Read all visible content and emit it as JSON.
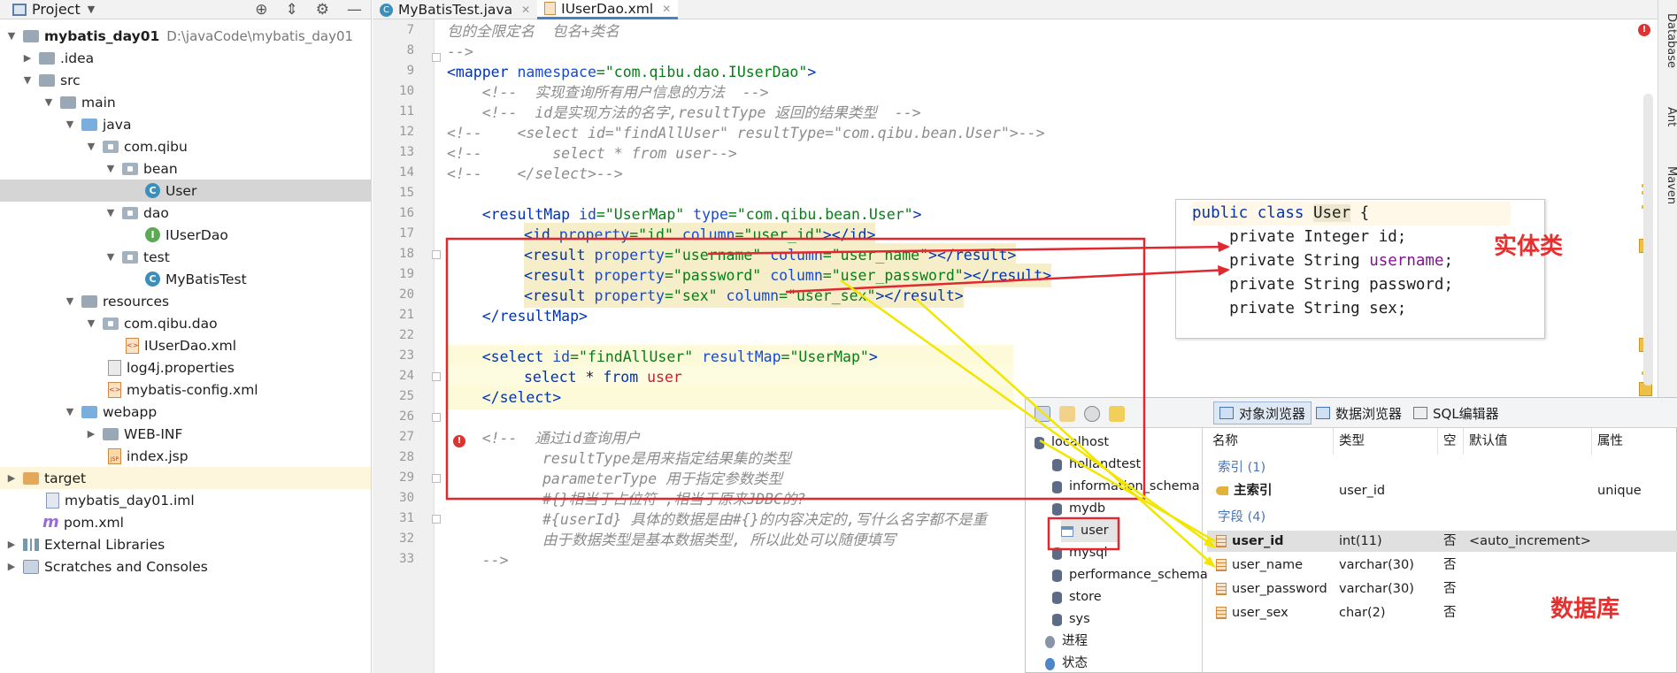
{
  "project_panel": {
    "title": "Project",
    "tree": [
      {
        "label": "mybatis_day01",
        "hint": "D:\\javaCode\\mybatis_day01"
      },
      {
        "label": ".idea"
      },
      {
        "label": "src"
      },
      {
        "label": "main"
      },
      {
        "label": "java"
      },
      {
        "label": "com.qibu"
      },
      {
        "label": "bean"
      },
      {
        "label": "User"
      },
      {
        "label": "dao"
      },
      {
        "label": "IUserDao"
      },
      {
        "label": "test"
      },
      {
        "label": "MyBatisTest"
      },
      {
        "label": "resources"
      },
      {
        "label": "com.qibu.dao"
      },
      {
        "label": "IUserDao.xml"
      },
      {
        "label": "log4j.properties"
      },
      {
        "label": "mybatis-config.xml"
      },
      {
        "label": "webapp"
      },
      {
        "label": "WEB-INF"
      },
      {
        "label": "index.jsp"
      },
      {
        "label": "target"
      },
      {
        "label": "mybatis_day01.iml"
      },
      {
        "label": "pom.xml"
      },
      {
        "label": "External Libraries"
      },
      {
        "label": "Scratches and Consoles"
      }
    ]
  },
  "tabs": [
    {
      "label": "MyBatisTest.java"
    },
    {
      "label": "IUserDao.xml"
    }
  ],
  "editor": {
    "line_numbers": [
      "7",
      "8",
      "9",
      "10",
      "11",
      "12",
      "13",
      "14",
      "15",
      "16",
      "17",
      "18",
      "19",
      "20",
      "21",
      "22",
      "23",
      "24",
      "25",
      "26",
      "27",
      "28",
      "29",
      "30",
      "31",
      "32",
      "33"
    ],
    "lines": {
      "l7": "包的全限定名  包名+类名",
      "l8": "-->",
      "l9a": "<mapper ",
      "l9b": "namespace",
      "l9c": "=\"com.qibu.dao.IUserDao\"",
      "l9d": ">",
      "l10": "    <!--  实现查询所有用户信息的方法  -->",
      "l11": "    <!--  id是实现方法的名字,resultType 返回的结果类型  -->",
      "l12": "<!--    <select id=\"findAllUser\" resultType=\"com.qibu.bean.User\">-->",
      "l13": "<!--        select * from user-->",
      "l14": "<!--    </select>-->",
      "l16a": "    <resultMap ",
      "l16b": "id",
      "l16c": "=\"UserMap\" ",
      "l16d": "type",
      "l16e": "=\"com.qibu.bean.User\"",
      "l16f": ">",
      "l17a": "<id ",
      "l17b": "property",
      "l17c": "=\"id\" ",
      "l17d": "column",
      "l17e": "=\"user_id\"",
      "l17f": "></id>",
      "l18a": "<result ",
      "l18b": "property",
      "l18c": "=\"username\" ",
      "l18d": "column",
      "l18e": "=\"user_name\"",
      "l18f": "></result>",
      "l19a": "<result ",
      "l19b": "property",
      "l19c": "=\"password\" ",
      "l19d": "column",
      "l19e": "=\"user_password\"",
      "l19f": "></result>",
      "l20a": "<result ",
      "l20b": "property",
      "l20c": "=\"sex\" ",
      "l20d": "column",
      "l20e": "=\"user_sex\"",
      "l20f": "></result>",
      "l21": "    </resultMap>",
      "l23a": "    <select ",
      "l23b": "id",
      "l23c": "=\"findAllUser\" ",
      "l23d": "resultMap",
      "l23e": "=\"UserMap\"",
      "l23f": ">",
      "l24a": "select",
      "l24b": " * ",
      "l24c": "from",
      "l24d": " user",
      "l25": "    </select>",
      "l27": "    <!--  通过id查询用户",
      "l28": "resultType是用来指定结果集的类型",
      "l29": "parameterType 用于指定参数类型",
      "l30": "#{}相当于占位符 ,相当于原来JDBC的?",
      "l31": "#{userId} 具体的数据是由#{}的内容决定的,写什么名字都不是重",
      "l32": "由于数据类型是基本数据类型, 所以此处可以随便填写",
      "l33": "    -->"
    }
  },
  "java_popup": {
    "line1a": "public class ",
    "line1b": "User",
    "line1c": " {",
    "line2": "    private Integer id;",
    "line3a": "    private String ",
    "line3b": "username",
    "line3c": ";",
    "line4": "    private String password;",
    "line5": "    private String sex;",
    "label": "实体类"
  },
  "db_panel": {
    "toolbar": {
      "object_browser": "对象浏览器",
      "data_browser": "数据浏览器",
      "sql_editor": "SQL编辑器"
    },
    "tree": [
      "localhost",
      "hollandtest",
      "information_schema",
      "mydb",
      "user",
      "mysql",
      "performance_schema",
      "store",
      "sys",
      "进程",
      "状态"
    ],
    "columns": [
      "名称",
      "类型",
      "空",
      "默认值",
      "属性"
    ],
    "index_section": "索引 (1)",
    "index_row": {
      "name": "主索引",
      "type": "user_id",
      "attr": "unique"
    },
    "fields_section": "字段 (4)",
    "fields": [
      {
        "name": "user_id",
        "type": "int(11)",
        "null": "否",
        "default": "<auto_increment>"
      },
      {
        "name": "user_name",
        "type": "varchar(30)",
        "null": "否",
        "default": ""
      },
      {
        "name": "user_password",
        "type": "varchar(30)",
        "null": "否",
        "default": ""
      },
      {
        "name": "user_sex",
        "type": "char(2)",
        "null": "否",
        "default": ""
      }
    ],
    "label": "数据库"
  },
  "right_sidebar": [
    "Database",
    "Ant",
    "Maven"
  ],
  "colors": {
    "annotation_red": "#e53030",
    "annotation_yellow": "#f2e600",
    "accent_blue": "#4083c9"
  }
}
